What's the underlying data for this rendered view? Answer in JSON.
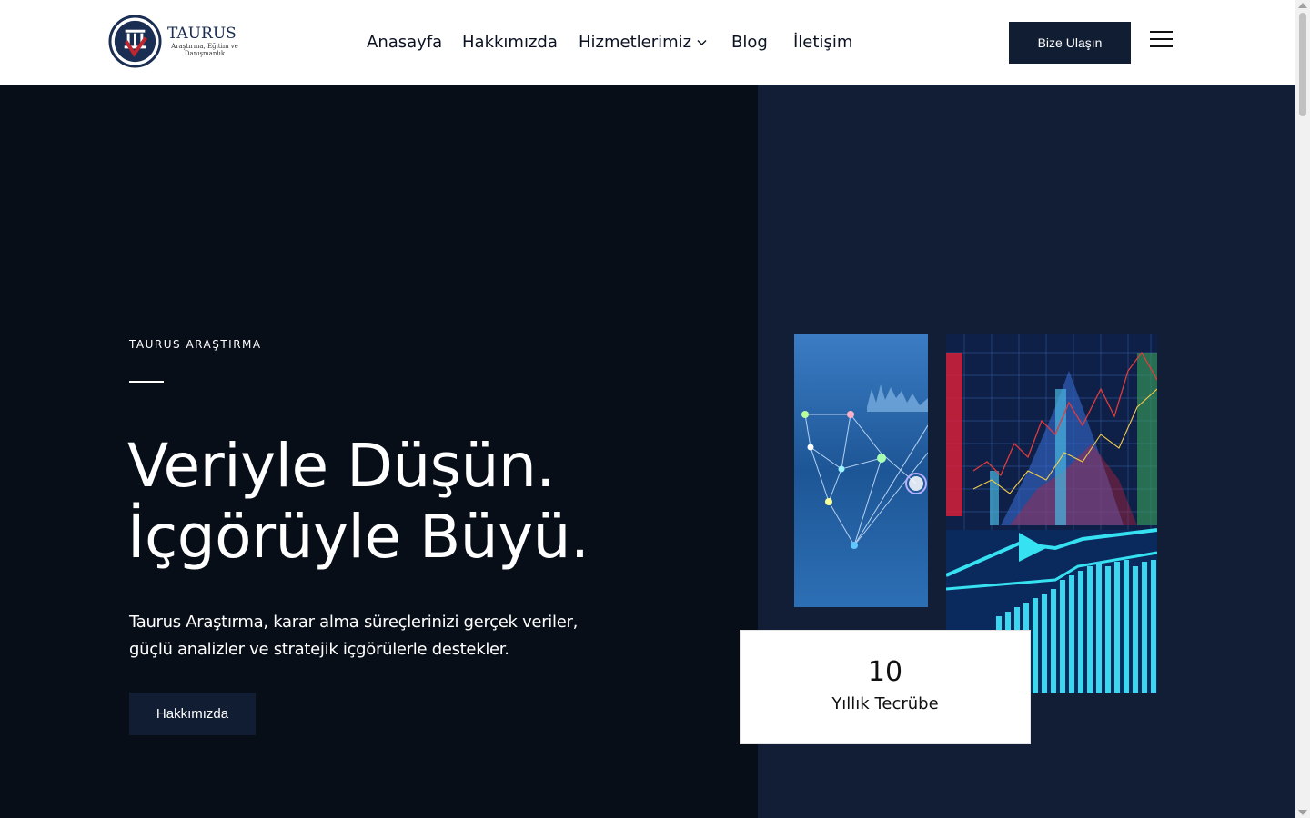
{
  "brand": {
    "name": "TAURUS",
    "subtitle": "Araştırma, Eğitim ve Danışmanlık"
  },
  "nav": {
    "items": [
      "Anasayfa",
      "Hakkımızda",
      "Hizmetlerimiz",
      "Blog",
      "İletişim"
    ],
    "cta": "Bize Ulaşın"
  },
  "hero": {
    "eyebrow": "TAURUS ARAŞTIRMA",
    "headline_line1": "Veriyle Düşün.",
    "headline_line2": "İçgörüyle Büyü.",
    "description": "Taurus Araştırma, karar alma süreçlerinizi gerçek veriler, güçlü analizler ve stratejik içgörülerle destekler.",
    "button": "Hakkımızda"
  },
  "stat": {
    "number": "10",
    "label": "Yıllık Tecrübe"
  },
  "colors": {
    "navy": "#111d33",
    "hero_dark": "#080e18",
    "hero_right": "#111e35"
  }
}
